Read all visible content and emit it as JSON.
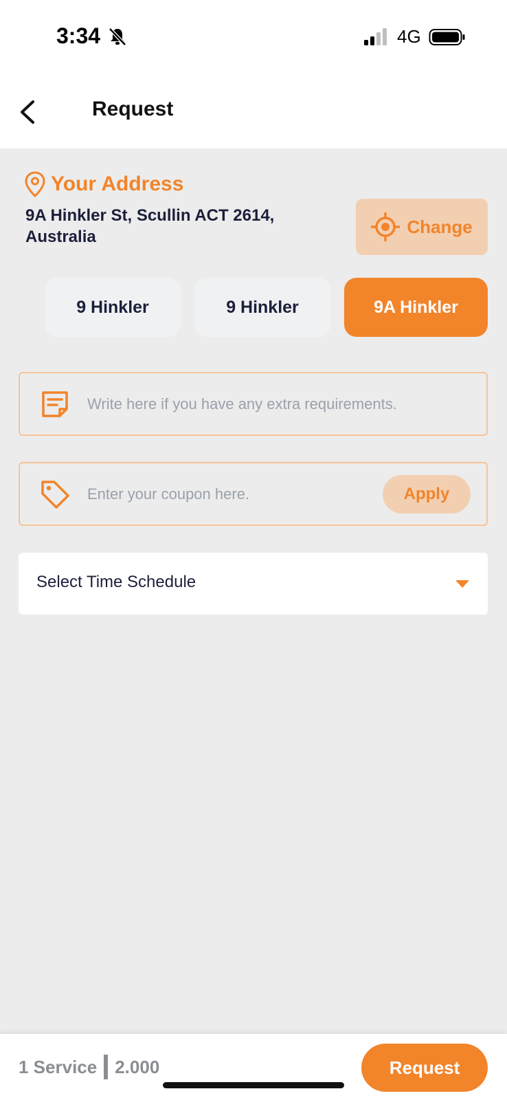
{
  "status_bar": {
    "time": "3:34",
    "network": "4G"
  },
  "header": {
    "title": "Request"
  },
  "address": {
    "label": "Your Address",
    "text": "9A Hinkler St, Scullin ACT 2614, Australia",
    "change_label": "Change"
  },
  "address_options": [
    {
      "label": "9 Hinkler",
      "selected": false
    },
    {
      "label": "9 Hinkler",
      "selected": false
    },
    {
      "label": "9A Hinkler",
      "selected": true
    }
  ],
  "notes": {
    "placeholder": "Write here if you have any extra requirements.",
    "value": ""
  },
  "coupon": {
    "placeholder": "Enter your coupon here.",
    "value": "",
    "apply_label": "Apply"
  },
  "schedule": {
    "label": "Select Time Schedule"
  },
  "footer": {
    "service_count": "1 Service",
    "price": "2.000",
    "request_label": "Request"
  },
  "colors": {
    "accent": "#f2842a",
    "accent_light": "#f3cfb2",
    "background": "#ececec",
    "text_dark": "#1c1f3a"
  }
}
